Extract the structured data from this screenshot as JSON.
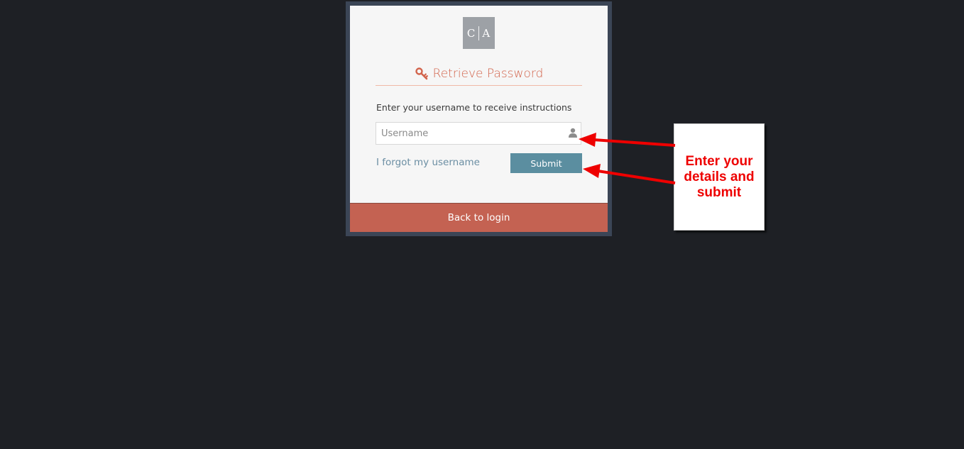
{
  "logo": {
    "left": "C",
    "right": "A"
  },
  "title": "Retrieve Password",
  "instruction": "Enter your username to receive instructions",
  "username": {
    "placeholder": "Username",
    "value": ""
  },
  "forgot_link": "I forgot my username",
  "submit_label": "Submit",
  "back_label": "Back to login",
  "callout_text": "Enter your details and submit",
  "colors": {
    "background": "#1e2025",
    "frame": "#3b4556",
    "panel": "#f6f6f6",
    "accent": "#d2644c",
    "submit": "#5b8ea0",
    "back_bar": "#c46252",
    "annotation": "#ee0000"
  },
  "icons": {
    "title": "key-icon",
    "username": "user-icon"
  }
}
